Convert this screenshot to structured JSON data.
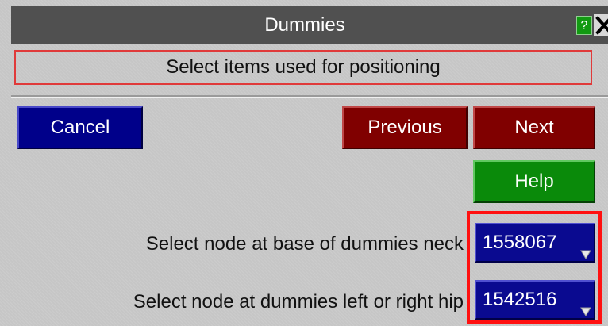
{
  "window": {
    "title": "Dummies",
    "help_glyph": "?",
    "close_icon": "close-icon"
  },
  "instruction": "Select items used for positioning",
  "buttons": {
    "cancel": "Cancel",
    "previous": "Previous",
    "next": "Next",
    "help": "Help"
  },
  "selections": [
    {
      "label": "Select node at base of dummies neck",
      "value": "1558067",
      "icon": "dropdown-arrow-icon"
    },
    {
      "label": "Select node at dummies left or right hip",
      "value": "1542516",
      "icon": "dropdown-arrow-icon"
    }
  ],
  "colors": {
    "cancel": "#00008a",
    "previous_next": "#800000",
    "help": "#0a8a0a",
    "field": "#0a0a90",
    "highlight": "#ff1010",
    "instruction_border": "#e03a3a"
  }
}
